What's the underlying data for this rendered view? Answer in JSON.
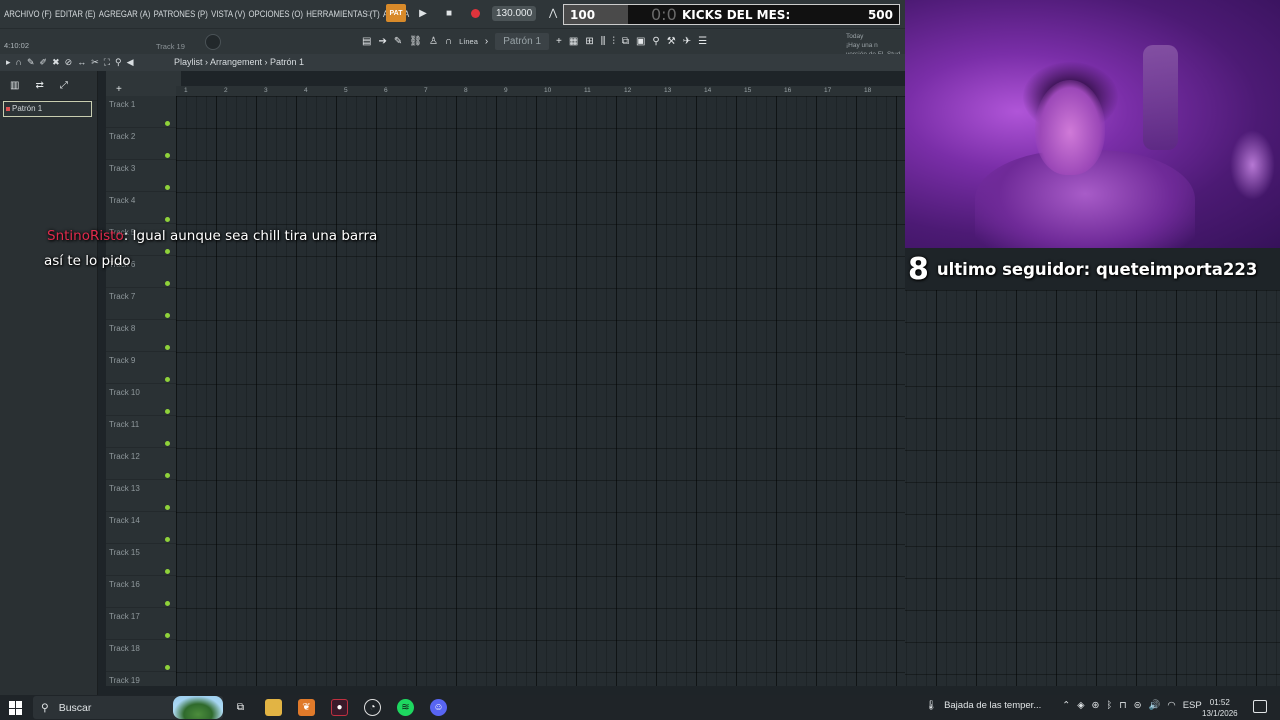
{
  "menu": [
    "ARCHIVO (F)",
    "EDITAR (E)",
    "AGREGAR (A)",
    "PATRONES (P)",
    "VISTA (V)",
    "OPCIONES (O)",
    "HERRAMIENTAS (T)",
    "AYUDA"
  ],
  "transport": {
    "pat_label": "PAT",
    "tempo": "130.000"
  },
  "donation_bar": {
    "min": "100",
    "ghost_time": "0:0",
    "label": "KICKS DEL MES:",
    "max": "500",
    "progress": 0.19
  },
  "status": {
    "time": "4:10:02",
    "track": "Track 19"
  },
  "toolbar2": {
    "snap_mode": "Línea",
    "pattern": "Patrón 1",
    "news": [
      "Today",
      "¡Hay una n",
      "versión de FL Stud"
    ]
  },
  "breadcrumb": "Playlist › Arrangement › Patrón 1",
  "picker": {
    "item": "Patrón 1"
  },
  "ruler": [
    "1",
    "2",
    "3",
    "4",
    "5",
    "6",
    "7",
    "8",
    "9",
    "10",
    "11",
    "12",
    "13",
    "14",
    "15",
    "16",
    "17",
    "18"
  ],
  "tracks": [
    "Track 1",
    "Track 2",
    "Track 3",
    "Track 4",
    "Track 5",
    "Track 6",
    "Track 7",
    "Track 8",
    "Track 9",
    "Track 10",
    "Track 11",
    "Track 12",
    "Track 13",
    "Track 14",
    "Track 15",
    "Track 16",
    "Track 17",
    "Track 18",
    "Track 19"
  ],
  "follower": {
    "count": "8",
    "text": "ultimo seguidor: queteimporta223"
  },
  "chat": {
    "user": "SntinoRisto",
    "message": ": Igual aunque sea chill tira una barra así te lo pido"
  },
  "taskbar": {
    "search_placeholder": "Buscar",
    "weather": "Bajada de las temper...",
    "lang": "ESP",
    "time": "01:52",
    "date": "13/1/2026"
  },
  "colors": {
    "accent_orange": "#d88a2a",
    "record_red": "#e0343c",
    "led_green": "#8fd23a",
    "chat_user": "#e02a4c"
  }
}
